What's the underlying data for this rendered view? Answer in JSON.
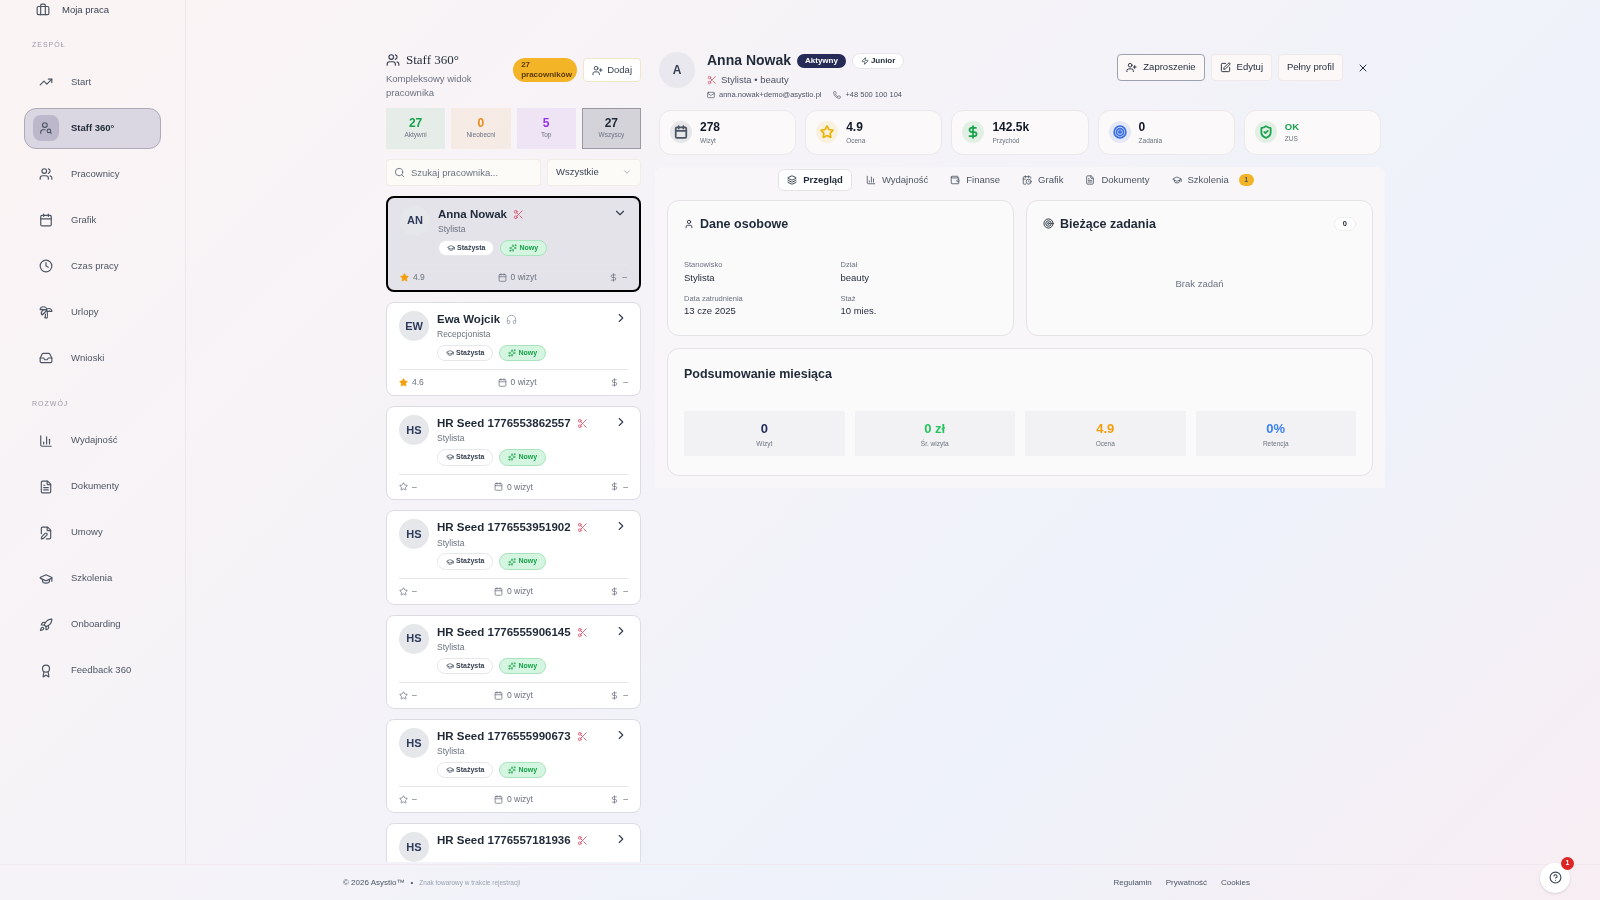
{
  "sidebar": {
    "top_item": {
      "label": "Moja praca"
    },
    "sections": [
      {
        "title": "ZESPÓŁ",
        "items": [
          {
            "label": "Start",
            "selected": false
          },
          {
            "label": "Staff 360°",
            "selected": true
          },
          {
            "label": "Pracownicy",
            "selected": false
          },
          {
            "label": "Grafik",
            "selected": false
          },
          {
            "label": "Czas pracy",
            "selected": false
          },
          {
            "label": "Urlopy",
            "selected": false
          },
          {
            "label": "Wnioski",
            "selected": false
          }
        ]
      },
      {
        "title": "ROZWÓJ",
        "items": [
          {
            "label": "Wydajność",
            "selected": false
          },
          {
            "label": "Dokumenty",
            "selected": false
          },
          {
            "label": "Umowy",
            "selected": false
          },
          {
            "label": "Szkolenia",
            "selected": false
          },
          {
            "label": "Onboarding",
            "selected": false
          },
          {
            "label": "Feedback 360",
            "selected": false
          }
        ]
      }
    ]
  },
  "staff_panel": {
    "title": "Staff 360°",
    "subtitle": "Kompleksowy widok pracownika",
    "count_badge": "27 pracowników",
    "add_button": "Dodaj",
    "tiles": [
      {
        "value": "27",
        "label": "Aktywni",
        "color": "#16a34a",
        "selected": false
      },
      {
        "value": "0",
        "label": "Nieobecni",
        "color": "#ea8a1a",
        "selected": false
      },
      {
        "value": "5",
        "label": "Top",
        "color": "#9333ea",
        "selected": false
      },
      {
        "value": "27",
        "label": "Wszyscy",
        "color": "#1f2937",
        "selected": true
      }
    ],
    "search": {
      "placeholder": "Szukaj pracownika..."
    },
    "filter": {
      "value": "Wszystkie"
    },
    "employees": [
      {
        "initials": "AN",
        "name": "Anna Nowak",
        "kind": "stylist",
        "role": "Stylista",
        "level": "Stażysta",
        "status": "Nowy",
        "rated": true,
        "rating": "4.9",
        "visits": "0 wizyt",
        "revenue": "–",
        "selected": true
      },
      {
        "initials": "EW",
        "name": "Ewa Wojcik",
        "kind": "reception",
        "role": "Recepcjonista",
        "level": "Stażysta",
        "status": "Nowy",
        "rated": true,
        "rating": "4.6",
        "visits": "0 wizyt",
        "revenue": "–",
        "selected": false
      },
      {
        "initials": "HS",
        "name": "HR Seed 1776553862557",
        "kind": "stylist",
        "role": "Stylista",
        "level": "Stażysta",
        "status": "Nowy",
        "rated": false,
        "rating": "–",
        "visits": "0 wizyt",
        "revenue": "–",
        "selected": false
      },
      {
        "initials": "HS",
        "name": "HR Seed 1776553951902",
        "kind": "stylist",
        "role": "Stylista",
        "level": "Stażysta",
        "status": "Nowy",
        "rated": false,
        "rating": "–",
        "visits": "0 wizyt",
        "revenue": "–",
        "selected": false
      },
      {
        "initials": "HS",
        "name": "HR Seed 1776555906145",
        "kind": "stylist",
        "role": "Stylista",
        "level": "Stażysta",
        "status": "Nowy",
        "rated": false,
        "rating": "–",
        "visits": "0 wizyt",
        "revenue": "–",
        "selected": false
      },
      {
        "initials": "HS",
        "name": "HR Seed 1776555990673",
        "kind": "stylist",
        "role": "Stylista",
        "level": "Stażysta",
        "status": "Nowy",
        "rated": false,
        "rating": "–",
        "visits": "0 wizyt",
        "revenue": "–",
        "selected": false
      },
      {
        "initials": "HS",
        "name": "HR Seed 1776557181936",
        "kind": "stylist",
        "selected": false
      }
    ]
  },
  "profile": {
    "initial": "A",
    "name": "Anna Nowak",
    "status": "Aktywny",
    "level": "Junior",
    "role_line": "Stylista • beauty",
    "email": "anna.nowak+demo@asystio.pl",
    "phone": "+48 500 100 104",
    "buttons": [
      "Zaproszenie",
      "Edytuj",
      "Pełny profil"
    ],
    "kpis": [
      {
        "value": "278",
        "label": "Wizyt",
        "color": "#4b5563",
        "kind": "number"
      },
      {
        "value": "4.9",
        "label": "Ocena",
        "color": "#eab308",
        "kind": "number"
      },
      {
        "value": "142.5k",
        "label": "Przychód",
        "color": "#16a34a",
        "kind": "number"
      },
      {
        "value": "0",
        "label": "Zadania",
        "color": "#3b6fe0",
        "kind": "number"
      },
      {
        "value": "OK",
        "label": "ZUS",
        "color": "#16a34a",
        "kind": "status"
      }
    ],
    "tabs": [
      {
        "label": "Przegląd",
        "selected": true
      },
      {
        "label": "Wydajność",
        "selected": false
      },
      {
        "label": "Finanse",
        "selected": false
      },
      {
        "label": "Grafik",
        "selected": false
      },
      {
        "label": "Dokumenty",
        "selected": false
      },
      {
        "label": "Szkolenia",
        "selected": false,
        "badge": "1"
      }
    ],
    "personal": {
      "title": "Dane osobowe",
      "fields": [
        {
          "label": "Stanowisko",
          "value": "Stylista"
        },
        {
          "label": "Dział",
          "value": "beauty"
        },
        {
          "label": "Data zatrudnienia",
          "value": "13 cze 2025"
        },
        {
          "label": "Staż",
          "value": "10 mies."
        }
      ]
    },
    "tasks": {
      "title": "Bieżące zadania",
      "count": "0",
      "empty": "Brak zadań"
    },
    "summary": {
      "title": "Podsumowanie miesiąca",
      "stats": [
        {
          "value": "0",
          "label": "Wizyt",
          "color": "#1e2a5a"
        },
        {
          "value": "0 zł",
          "label": "Śr. wizyta",
          "color": "#22c55e"
        },
        {
          "value": "4.9",
          "label": "Ocena",
          "color": "#f59e0b"
        },
        {
          "value": "0%",
          "label": "Retencja",
          "color": "#3b82f6"
        }
      ]
    }
  },
  "footer": {
    "copyright": "© 2026 Asystio™",
    "separator": "•",
    "note": "Znak towarowy w trakcie rejestracji",
    "links": [
      "Regulamin",
      "Prywatność",
      "Cookies"
    ]
  },
  "help": {
    "badge": "1"
  }
}
